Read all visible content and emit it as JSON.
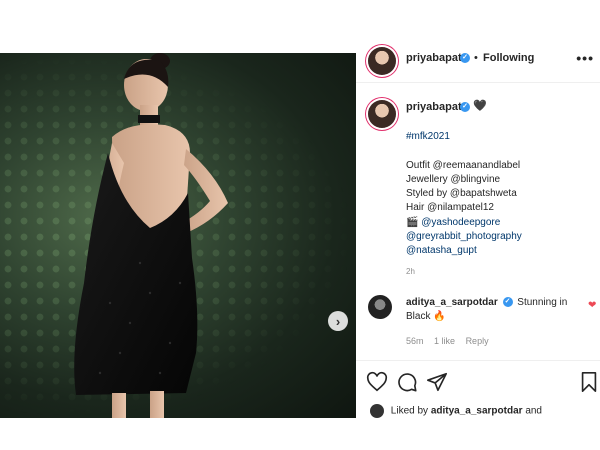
{
  "post": {
    "image_alt": "",
    "next_icon": "chevron-right-icon"
  },
  "header": {
    "username": "priyabapat",
    "separator": "•",
    "follow_status": "Following",
    "more_icon": "more-horizontal-icon",
    "more_label": "•••"
  },
  "caption": {
    "username": "priyabapat",
    "lines": [
      "#mfk2021",
      "",
      "Outfit @reemaanandlabel",
      "Jewellery @blingvine",
      "Styled by @bapatshweta",
      "Hair @nilampatel12",
      "🎬 @yashodeepgore",
      "@greyrabbit_photography",
      "@natasha_gupt"
    ],
    "timestamp": "2h"
  },
  "comment": {
    "username": "aditya_a_sarpotdar",
    "text": "Stunning in Black 🔥",
    "time": "56m",
    "likes": "1 like",
    "reply_label": "Reply"
  },
  "actions": {
    "like_icon": "heart-outline-icon",
    "comment_icon": "comment-icon",
    "share_icon": "share-icon",
    "save_icon": "bookmark-icon"
  },
  "liked_by": {
    "prefix": "Liked by",
    "user": "aditya_a_sarpotdar",
    "suffix": "and"
  },
  "colors": {
    "verified": "#3897f0",
    "link": "#00376b",
    "heart_red": "#ed4956"
  }
}
